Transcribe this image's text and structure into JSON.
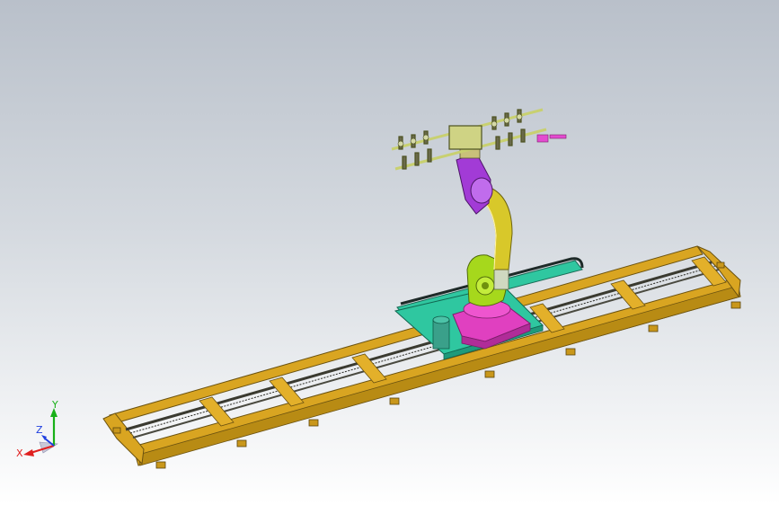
{
  "viewport": {
    "triad": {
      "x_label": "X",
      "y_label": "Y",
      "z_label": "Z"
    }
  },
  "colors": {
    "background_top": "#b9c0ca",
    "rail_frame": "#d9a521",
    "rail_frame_dark": "#8a6a12",
    "rail_track": "#3a3a30",
    "carriage_plate": "#2fc7a0",
    "robot_base": "#e040c0",
    "robot_body": "#a6d81c",
    "robot_arm": "#d8c82a",
    "wrist": "#a23bd6",
    "gripper": "#c8d070",
    "axis_x": "#e02020",
    "axis_y": "#18b018",
    "axis_z": "#2040e0"
  },
  "icons": [
    "coordinate-triad-icon"
  ]
}
